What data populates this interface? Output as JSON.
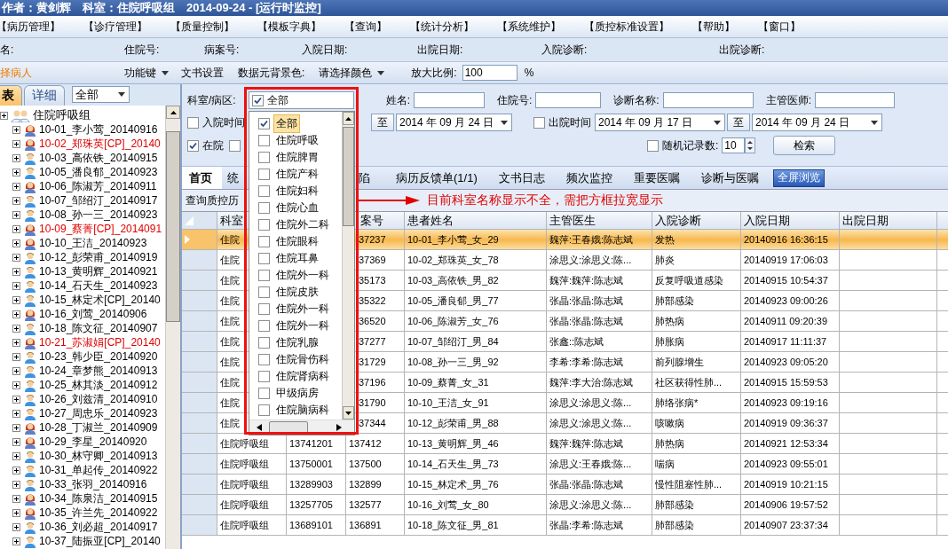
{
  "window": {
    "title": "作者：黄剑辉　科室：住院呼吸组　2014-09-24 - [运行时监控]"
  },
  "menu": [
    "【病历管理】",
    "【诊疗管理】",
    "【质量控制】",
    "【模板字典】",
    "【查询】",
    "【统计分析】",
    "【系统维护】",
    "【质控标准设置】",
    "【帮助】",
    "【窗口】"
  ],
  "info_bar": [
    "名:",
    "住院号:",
    "病案号:",
    "入院日期:",
    "出院日期:",
    "入院诊断:",
    "出院诊断:"
  ],
  "toolbar": {
    "patient_link": "择病人",
    "function_key": "功能键",
    "doc_settings": "文书设置",
    "bg_label": "数据元背景色:",
    "bg_select": "请选择颜色",
    "zoom_label": "放大比例:",
    "zoom_value": "100",
    "zoom_unit": "%"
  },
  "left_panel": {
    "tabs": [
      {
        "label": "表",
        "selected": true
      },
      {
        "label": "详细",
        "selected": false
      }
    ],
    "filter": "全部",
    "tree": {
      "label": "住院呼吸组",
      "children": [
        {
          "label": "10-01_李小莺_20140916",
          "kind": "female",
          "flagged": false
        },
        {
          "label": "10-02_郑珠英[CP]_20140",
          "kind": "female",
          "flagged": true
        },
        {
          "label": "10-03_高依铁_20140915",
          "kind": "male",
          "flagged": false
        },
        {
          "label": "10-05_潘良郁_20140923",
          "kind": "male",
          "flagged": false
        },
        {
          "label": "10-06_陈淑芳_20140911",
          "kind": "female",
          "flagged": false
        },
        {
          "label": "10-07_邹绍汀_20140917",
          "kind": "male",
          "flagged": false
        },
        {
          "label": "10-08_孙一三_20140923",
          "kind": "male",
          "flagged": false
        },
        {
          "label": "10-09_蔡菁[CP]_2014091",
          "kind": "female",
          "flagged": true
        },
        {
          "label": "10-10_王洁_20140923",
          "kind": "female",
          "flagged": false
        },
        {
          "label": "10-12_彭荣甫_20140919",
          "kind": "male",
          "flagged": false
        },
        {
          "label": "10-13_黄明辉_20140921",
          "kind": "male",
          "flagged": false
        },
        {
          "label": "10-14_石天生_20140923",
          "kind": "male",
          "flagged": false
        },
        {
          "label": "10-15_林定术[CP]_20140",
          "kind": "male",
          "flagged": false
        },
        {
          "label": "10-16_刘莺_20140906",
          "kind": "female",
          "flagged": false
        },
        {
          "label": "10-18_陈文征_20140907",
          "kind": "male",
          "flagged": false
        },
        {
          "label": "10-21_苏淑娟[CP]_20140",
          "kind": "female",
          "flagged": true
        },
        {
          "label": "10-23_韩少臣_20140920",
          "kind": "male",
          "flagged": false
        },
        {
          "label": "10-24_章梦熊_20140913",
          "kind": "male",
          "flagged": false
        },
        {
          "label": "10-25_林其淡_20140912",
          "kind": "male",
          "flagged": false
        },
        {
          "label": "10-26_刘兹清_20140910",
          "kind": "male",
          "flagged": false
        },
        {
          "label": "10-27_周忠乐_20140923",
          "kind": "male",
          "flagged": false
        },
        {
          "label": "10-28_丁淑兰_20140909",
          "kind": "female",
          "flagged": false
        },
        {
          "label": "10-29_李星_20140920",
          "kind": "female",
          "flagged": false
        },
        {
          "label": "10-30_林守卿_20140913",
          "kind": "male",
          "flagged": false
        },
        {
          "label": "10-31_单起传_20140922",
          "kind": "male",
          "flagged": false
        },
        {
          "label": "10-33_张羽_20140916",
          "kind": "male",
          "flagged": false
        },
        {
          "label": "10-34_陈泉洁_20140915",
          "kind": "female",
          "flagged": false
        },
        {
          "label": "10-35_许兰先_20140922",
          "kind": "female",
          "flagged": false
        },
        {
          "label": "10-36_刘必超_20140917",
          "kind": "male",
          "flagged": false
        },
        {
          "label": "10-37_陆振亚[CP]_20140",
          "kind": "male",
          "flagged": false
        }
      ]
    }
  },
  "filters": {
    "department": {
      "label": "科室/病区:",
      "checked": true,
      "value": "全部",
      "options": [
        {
          "label": "全部",
          "checked": true,
          "selected": true
        },
        {
          "label": "住院呼吸",
          "checked": false,
          "selected": false
        },
        {
          "label": "住院脾胃",
          "checked": false,
          "selected": false
        },
        {
          "label": "住院产科",
          "checked": false,
          "selected": false
        },
        {
          "label": "住院妇科",
          "checked": false,
          "selected": false
        },
        {
          "label": "住院心血",
          "checked": false,
          "selected": false
        },
        {
          "label": "住院外二科",
          "checked": false,
          "selected": false
        },
        {
          "label": "住院眼科",
          "checked": false,
          "selected": false
        },
        {
          "label": "住院耳鼻",
          "checked": false,
          "selected": false
        },
        {
          "label": "住院外一科",
          "checked": false,
          "selected": false
        },
        {
          "label": "住院皮肤",
          "checked": false,
          "selected": false
        },
        {
          "label": "住院外一科",
          "checked": false,
          "selected": false
        },
        {
          "label": "住院外一科",
          "checked": false,
          "selected": false
        },
        {
          "label": "住院乳腺",
          "checked": false,
          "selected": false
        },
        {
          "label": "住院骨伤科",
          "checked": false,
          "selected": false
        },
        {
          "label": "住院肾病科",
          "checked": false,
          "selected": false
        },
        {
          "label": "甲级病房",
          "checked": false,
          "selected": false
        },
        {
          "label": "住院脑病科",
          "checked": false,
          "selected": false
        }
      ]
    },
    "fields": [
      {
        "label": "姓名:"
      },
      {
        "label": "住院号:"
      },
      {
        "label": "诊断名称:"
      },
      {
        "label": "主管医师:"
      }
    ],
    "admit_time": {
      "label": "入院时间",
      "checked": false,
      "to": "至",
      "end": "2014 年 09 月 24 日"
    },
    "discharge_time": {
      "label": "出院时间",
      "checked": false,
      "start": "2014 年 09 月 17 日",
      "to": "至",
      "end": "2014 年 09 月 24 日"
    },
    "in_hospital": {
      "label": "在院",
      "checked": true
    },
    "other_check": {
      "checked": false
    },
    "random": {
      "label": "随机记录数:",
      "checked": false,
      "value": "10"
    },
    "search_button": "检索"
  },
  "tabs": [
    {
      "label": "首页",
      "selected": true
    },
    {
      "label": "统",
      "selected": false
    },
    {
      "label": "陷",
      "selected": false
    },
    {
      "label": "病历反馈单(1/1)",
      "selected": false
    },
    {
      "label": "文书日志",
      "selected": false
    },
    {
      "label": "频次监控",
      "selected": false
    },
    {
      "label": "重要医嘱",
      "selected": false
    },
    {
      "label": "诊断与医嘱",
      "selected": false
    }
  ],
  "fullscreen_button": "全屏浏览",
  "history_button": "查询质控历",
  "annotation": "目前科室名称显示不全，需把方框拉宽显示",
  "table": {
    "columns": [
      "科室",
      null,
      "案号",
      "患者姓名",
      "主管医生",
      "入院诊断",
      "入院日期",
      "出院日期"
    ],
    "rows": [
      {
        "selected": true,
        "covered": true,
        "cells": [
          "住院",
          null,
          "37237",
          "10-01_李小莺_女_29",
          "魏萍:王春娥:陈志斌",
          "发热",
          "20140916 16:36:15",
          null
        ]
      },
      {
        "selected": false,
        "covered": true,
        "cells": [
          "住院",
          null,
          "37369",
          "10-02_郑珠英_女_78",
          "涂思义:涂思义:陈...",
          "肺炎",
          "20140919 17:06:03",
          null
        ]
      },
      {
        "selected": false,
        "covered": true,
        "cells": [
          "住院",
          null,
          "35173",
          "10-03_高依铁_男_82",
          "魏萍:魏萍:陈志斌",
          "反复呼吸道感染",
          "20140915 10:54:37",
          null
        ]
      },
      {
        "selected": false,
        "covered": true,
        "cells": [
          "住院",
          null,
          "35322",
          "10-05_潘良郁_男_77",
          "张晶:张晶:陈志斌",
          "肺部感染",
          "20140923 09:00:26",
          null
        ]
      },
      {
        "selected": false,
        "covered": true,
        "cells": [
          "住院",
          null,
          "36520",
          "10-06_陈淑芳_女_76",
          "张晶:张晶:陈志斌",
          "肺热病",
          "20140911 09:20:39",
          null
        ]
      },
      {
        "selected": false,
        "covered": true,
        "cells": [
          "住院",
          null,
          "37277",
          "10-07_邹绍汀_男_84",
          "张鑫::陈志斌",
          "肺胀病",
          "20140917 11:11:37",
          null
        ]
      },
      {
        "selected": false,
        "covered": true,
        "cells": [
          "住院",
          null,
          "31729",
          "10-08_孙一三_男_92",
          "李希:李希:陈志斌",
          "前列腺增生",
          "20140923 09:05:20",
          null
        ]
      },
      {
        "selected": false,
        "covered": true,
        "cells": [
          "住院",
          null,
          "37196",
          "10-09_蔡菁_女_31",
          "魏萍:李大治:陈志斌",
          "社区获得性肺...",
          "20140915 15:59:53",
          null
        ]
      },
      {
        "selected": false,
        "covered": true,
        "cells": [
          "住院",
          null,
          "31790",
          "10-10_王洁_女_91",
          "涂思义:涂思义:陈...",
          "肺络张病*",
          "20140923 09:19:16",
          null
        ]
      },
      {
        "selected": false,
        "covered": true,
        "cells": [
          "住院",
          null,
          "37344",
          "10-12_彭荣甫_男_88",
          "涂思义:涂思义:陈...",
          "咳嗽病",
          "20140919 09:36:37",
          null
        ]
      },
      {
        "selected": false,
        "covered": false,
        "cells": [
          "住院呼吸组",
          "13741201",
          "137412",
          "10-13_黄明辉_男_46",
          "魏萍:魏萍:陈志斌",
          "肺热病",
          "20140921 12:53:34",
          null
        ]
      },
      {
        "selected": false,
        "covered": false,
        "cells": [
          "住院呼吸组",
          "13750001",
          "137500",
          "10-14_石天生_男_73",
          "涂思义:王春娥:陈...",
          "喘病",
          "20140923 09:55:01",
          null
        ]
      },
      {
        "selected": false,
        "covered": false,
        "cells": [
          "住院呼吸组",
          "13289903",
          "132899",
          "10-15_林定术_男_76",
          "张晶:张晶:陈志斌",
          "慢性阻塞性肺...",
          "20140919 10:21:15",
          null
        ]
      },
      {
        "selected": false,
        "covered": false,
        "cells": [
          "住院呼吸组",
          "13257705",
          "132577",
          "10-16_刘莺_女_80",
          "涂思义:涂思义:陈...",
          "肺部感染",
          "20140906 19:57:52",
          null
        ]
      },
      {
        "selected": false,
        "covered": false,
        "cells": [
          "住院呼吸组",
          "13689101",
          "136891",
          "10-18_陈文征_男_81",
          "张晶:李希:陈志斌",
          "肺部感染",
          "20140907 23:37:34",
          null
        ]
      }
    ]
  }
}
